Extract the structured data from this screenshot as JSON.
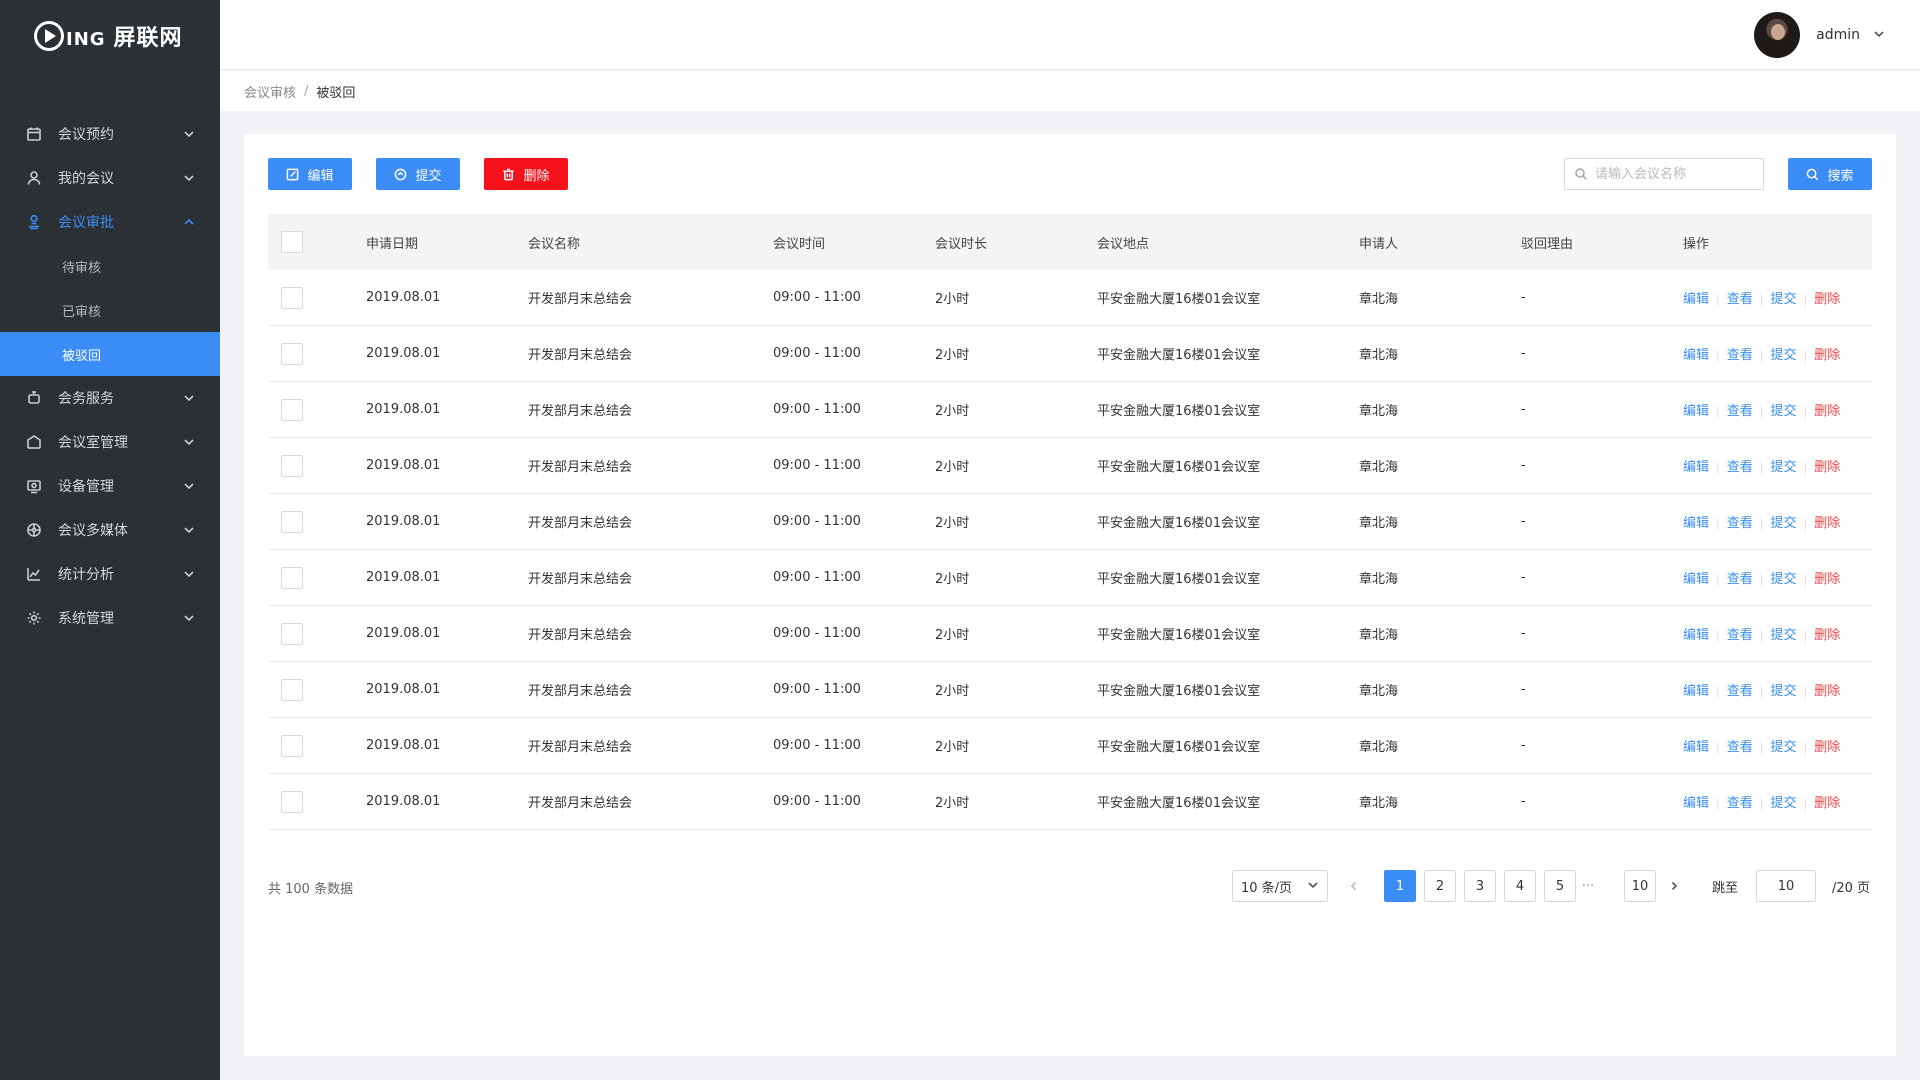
{
  "logo": {
    "play": "",
    "small": "ING",
    "name": "屏联网"
  },
  "sidebar": {
    "items": [
      {
        "label": "会议预约",
        "icon": "calendar-icon",
        "open": false
      },
      {
        "label": "我的会议",
        "icon": "user-icon",
        "open": false
      },
      {
        "label": "会议审批",
        "icon": "approval-icon",
        "open": true,
        "children": [
          {
            "label": "待审核",
            "active": false
          },
          {
            "label": "已审核",
            "active": false
          },
          {
            "label": "被驳回",
            "active": true
          }
        ]
      },
      {
        "label": "会务服务",
        "icon": "service-icon",
        "open": false
      },
      {
        "label": "会议室管理",
        "icon": "room-icon",
        "open": false
      },
      {
        "label": "设备管理",
        "icon": "device-icon",
        "open": false
      },
      {
        "label": "会议多媒体",
        "icon": "media-icon",
        "open": false
      },
      {
        "label": "统计分析",
        "icon": "chart-icon",
        "open": false
      },
      {
        "label": "系统管理",
        "icon": "gear-icon",
        "open": false
      }
    ]
  },
  "header": {
    "username": "admin"
  },
  "breadcrumb": {
    "parent": "会议审核",
    "separator": "/",
    "current": "被驳回"
  },
  "toolbar": {
    "edit": "编辑",
    "submit": "提交",
    "delete": "删除",
    "search_placeholder": "请输入会议名称",
    "search": "搜索"
  },
  "table": {
    "headers": [
      "申请日期",
      "会议名称",
      "会议时间",
      "会议时长",
      "会议地点",
      "申请人",
      "驳回理由",
      "操作"
    ],
    "ops": {
      "edit": "编辑",
      "view": "查看",
      "submit": "提交",
      "delete": "删除",
      "sep": "|"
    },
    "rows": [
      {
        "date": "2019.08.01",
        "name": "开发部月末总结会",
        "time": "09:00 - 11:00",
        "duration": "2小时",
        "location": "平安金融大厦16楼01会议室",
        "applicant": "章北海",
        "reason": "-"
      },
      {
        "date": "2019.08.01",
        "name": "开发部月末总结会",
        "time": "09:00 - 11:00",
        "duration": "2小时",
        "location": "平安金融大厦16楼01会议室",
        "applicant": "章北海",
        "reason": "-"
      },
      {
        "date": "2019.08.01",
        "name": "开发部月末总结会",
        "time": "09:00 - 11:00",
        "duration": "2小时",
        "location": "平安金融大厦16楼01会议室",
        "applicant": "章北海",
        "reason": "-"
      },
      {
        "date": "2019.08.01",
        "name": "开发部月末总结会",
        "time": "09:00 - 11:00",
        "duration": "2小时",
        "location": "平安金融大厦16楼01会议室",
        "applicant": "章北海",
        "reason": "-"
      },
      {
        "date": "2019.08.01",
        "name": "开发部月末总结会",
        "time": "09:00 - 11:00",
        "duration": "2小时",
        "location": "平安金融大厦16楼01会议室",
        "applicant": "章北海",
        "reason": "-"
      },
      {
        "date": "2019.08.01",
        "name": "开发部月末总结会",
        "time": "09:00 - 11:00",
        "duration": "2小时",
        "location": "平安金融大厦16楼01会议室",
        "applicant": "章北海",
        "reason": "-"
      },
      {
        "date": "2019.08.01",
        "name": "开发部月末总结会",
        "time": "09:00 - 11:00",
        "duration": "2小时",
        "location": "平安金融大厦16楼01会议室",
        "applicant": "章北海",
        "reason": "-"
      },
      {
        "date": "2019.08.01",
        "name": "开发部月末总结会",
        "time": "09:00 - 11:00",
        "duration": "2小时",
        "location": "平安金融大厦16楼01会议室",
        "applicant": "章北海",
        "reason": "-"
      },
      {
        "date": "2019.08.01",
        "name": "开发部月末总结会",
        "time": "09:00 - 11:00",
        "duration": "2小时",
        "location": "平安金融大厦16楼01会议室",
        "applicant": "章北海",
        "reason": "-"
      },
      {
        "date": "2019.08.01",
        "name": "开发部月末总结会",
        "time": "09:00 - 11:00",
        "duration": "2小时",
        "location": "平安金融大厦16楼01会议室",
        "applicant": "章北海",
        "reason": "-"
      }
    ]
  },
  "pagination": {
    "total": "共 100 条数据",
    "page_size": "10 条/页",
    "pages": [
      "1",
      "2",
      "3",
      "4",
      "5"
    ],
    "dots": "···",
    "last_page": "10",
    "current": "1",
    "jump_label": "跳至",
    "jump_value": "10",
    "total_pages": "/20 页"
  },
  "colors": {
    "accent": "#3b8cf5",
    "danger": "#f5121b",
    "sidebar": "#2b3035"
  }
}
